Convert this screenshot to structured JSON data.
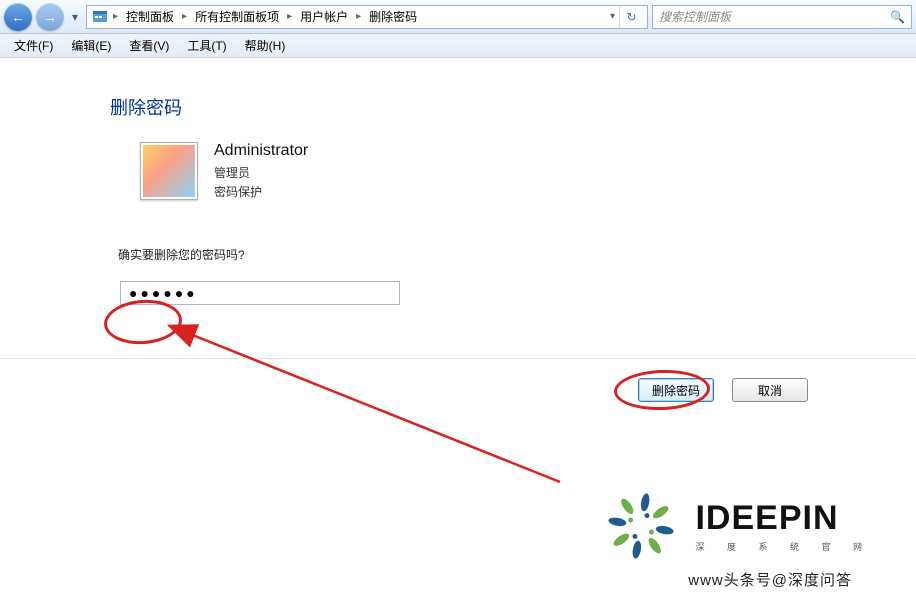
{
  "nav": {
    "back": "←",
    "fwd": "→",
    "dd": "▾"
  },
  "breadcrumb": {
    "items": [
      "控制面板",
      "所有控制面板项",
      "用户帐户",
      "删除密码"
    ],
    "sep": "▸",
    "refresh": "↻"
  },
  "search": {
    "placeholder": "搜索控制面板",
    "icon": "🔍"
  },
  "menu": {
    "file": "文件(F)",
    "edit": "编辑(E)",
    "view": "查看(V)",
    "tools": "工具(T)",
    "help": "帮助(H)"
  },
  "page": {
    "title": "删除密码",
    "user_name": "Administrator",
    "user_role": "管理员",
    "user_status": "密码保护",
    "prompt": "确实要删除您的密码吗?",
    "password_mask": "●●●●●●"
  },
  "buttons": {
    "delete": "删除密码",
    "cancel": "取消"
  },
  "watermark": {
    "brand": "IDEEPIN",
    "tag": "深 度 系 统 官 网",
    "credit": "www头条号@深度问答"
  }
}
